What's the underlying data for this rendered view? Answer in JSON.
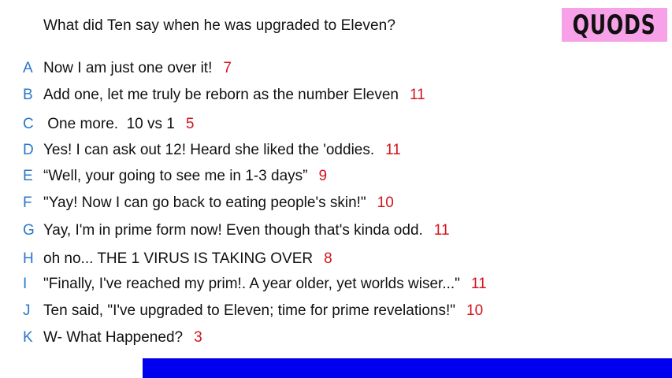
{
  "question": "What did Ten say when he was upgraded to Eleven?",
  "logo_text": "QUODS",
  "colors": {
    "letter": "#2a77c9",
    "score": "#d4141e",
    "logo_bg": "#f7a1e8",
    "bar": "#0000ee"
  },
  "answers": [
    {
      "letter": "A",
      "text": "Now I am just one over it!",
      "score": "7"
    },
    {
      "letter": "B",
      "text": "Add one, let me truly be reborn as the number Eleven",
      "score": "11"
    },
    {
      "letter": "C",
      "text": " One more.  10 vs 1",
      "score": "5"
    },
    {
      "letter": "D",
      "text": "Yes! I can ask out 12! Heard she liked the 'oddies.",
      "score": "11"
    },
    {
      "letter": "E",
      "text": "“Well, your going to see me in 1-3 days”",
      "score": "9"
    },
    {
      "letter": "F",
      "text": "\"Yay! Now I can go back to eating people's skin!\"",
      "score": "10"
    },
    {
      "letter": "G",
      "text": "Yay, I'm in prime form now! Even though that's kinda odd.",
      "score": "11"
    },
    {
      "letter": "H",
      "text": "oh no... THE 1 VIRUS IS TAKING OVER",
      "score": "8"
    },
    {
      "letter": "I",
      "text": "\"Finally, I've reached my prim!. A year older, yet worlds wiser...\"",
      "score": "11"
    },
    {
      "letter": "J",
      "text": "Ten said, \"I've upgraded to Eleven; time for prime revelations!\"",
      "score": "10"
    },
    {
      "letter": "K",
      "text": "W- What Happened?",
      "score": "3"
    }
  ]
}
